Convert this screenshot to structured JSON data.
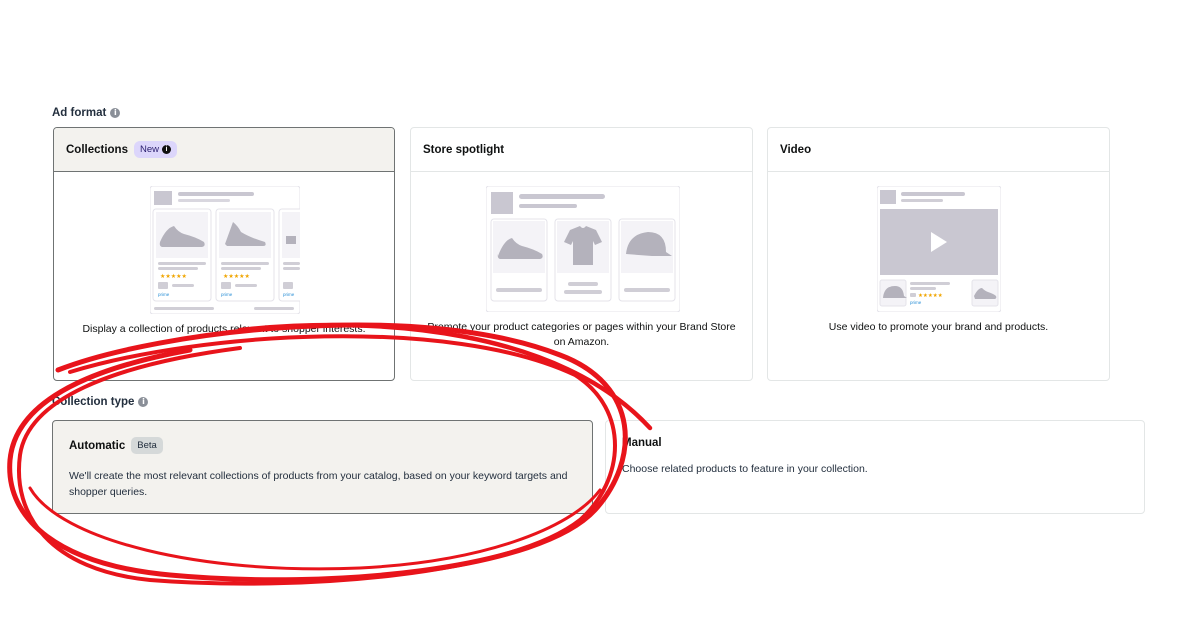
{
  "ad_format": {
    "label": "Ad format",
    "cards": [
      {
        "title": "Collections",
        "badge": "New",
        "description": "Display a collection of products relevant to shopper interests.",
        "selected": true
      },
      {
        "title": "Store spotlight",
        "description": "Promote your product categories or pages within your Brand Store on Amazon.",
        "selected": false
      },
      {
        "title": "Video",
        "description": "Use video to promote your brand and products.",
        "selected": false
      }
    ]
  },
  "collection_type": {
    "label": "Collection type",
    "cards": [
      {
        "title": "Automatic",
        "badge": "Beta",
        "description": "We'll create the most relevant collections of products from your catalog, based on your keyword targets and shopper queries.",
        "selected": true
      },
      {
        "title": "Manual",
        "description": "Choose related products to feature in your collection.",
        "selected": false
      }
    ]
  },
  "illustration": {
    "prime_label": "prime"
  },
  "colors": {
    "annotation_red": "#e8141b",
    "selected_bg": "#f3f2ee",
    "placeholder_gray": "#c9c7d1",
    "star_orange": "#f0a500",
    "badge_purple": "#dcd6fb"
  }
}
